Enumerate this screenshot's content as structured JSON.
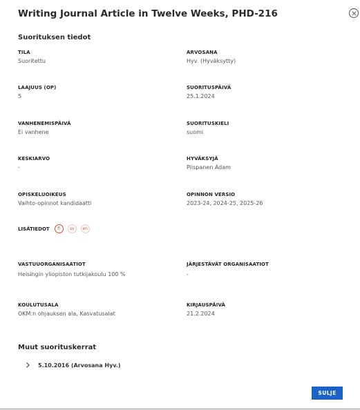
{
  "dialog": {
    "title": "Writing Journal Article in Twelve Weeks, PHD-216",
    "close_icon": "close-circle-icon",
    "details_heading": "Suorituksen tiedot",
    "fields": {
      "tila": {
        "label": "TILA",
        "value": "Suoritettu"
      },
      "arvosana": {
        "label": "ARVOSANA",
        "value": "Hyv. (Hyväksytty)"
      },
      "laajuus": {
        "label": "LAAJUUS (OP)",
        "value": "5"
      },
      "suorituspaiva": {
        "label": "SUORITUSPÄIVÄ",
        "value": "25.1.2024"
      },
      "vanhenemispaiva": {
        "label": "VANHENEMISPÄIVÄ",
        "value": "Ei vanhene"
      },
      "suorituskieli": {
        "label": "SUORITUSKIELI",
        "value": "suomi"
      },
      "keskiarvo": {
        "label": "KESKIARVO",
        "value": "-"
      },
      "hyvaksyja": {
        "label": "HYVÄKSYJÄ",
        "value": "Piispanen Adam"
      },
      "opiskeluoikeus": {
        "label": "OPISKELUOIKEUS",
        "value": "Vaihto-opinnot kandidaatti"
      },
      "opinnon_versio": {
        "label": "OPINNON VERSIO",
        "value": "2023-24, 2024-25, 2025-26"
      },
      "vastuuorganisaatiot": {
        "label": "VASTUUORGANISAATIOT",
        "value": "Helsingin yliopiston tutkijakoulu 100 %"
      },
      "jarjestavat": {
        "label": "JÄRJESTÄVÄT ORGANISAATIOT",
        "value": "-"
      },
      "koulutusala": {
        "label": "KOULUTUSALA",
        "value": "OKM:n ohjauksen ala, Kasvatusalat"
      },
      "kirjauspaiva": {
        "label": "KIRJAUSPÄIVÄ",
        "value": "21.2.2024"
      }
    },
    "lisatiedot": {
      "label": "LISÄTIEDOT",
      "languages": [
        "fi",
        "sv",
        "en"
      ],
      "selected": "fi"
    },
    "other_attempts_heading": "Muut suorituskerrat",
    "other_attempts": [
      {
        "text": "5.10.2016 (Arvosana Hyv.)",
        "icon": "chevron-right-icon"
      }
    ],
    "close_button_label": "SULJE",
    "colors": {
      "accent": "#1a62c7",
      "language_badge": "#c0522f"
    }
  }
}
